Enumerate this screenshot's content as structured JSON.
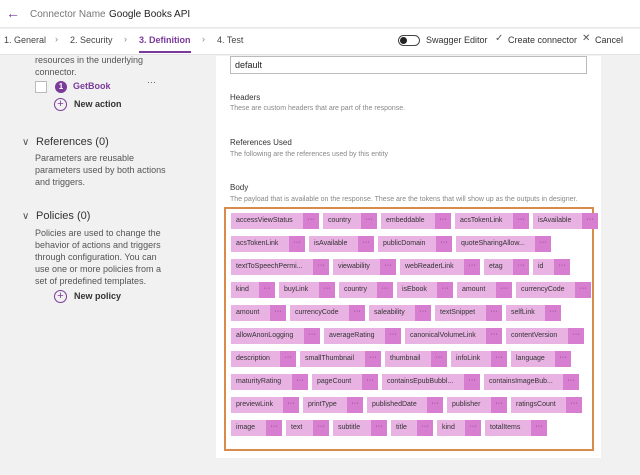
{
  "header": {
    "back_icon": "back-arrow-icon",
    "connector_label": "Connector Name",
    "connector_value": "Google Books API"
  },
  "steps": [
    "1. General",
    "2. Security",
    "3. Definition",
    "4. Test"
  ],
  "active_step": 2,
  "toolbar": {
    "swagger_label": "Swagger Editor",
    "swagger_on": false,
    "create_label": "Create connector",
    "cancel_label": "Cancel"
  },
  "sidebar": {
    "actions_text": [
      "resources in the underlying",
      "connector."
    ],
    "action": {
      "number": "1",
      "name": "GetBook",
      "more": "···"
    },
    "new_action": "New action",
    "references": {
      "title": "References (0)",
      "text": [
        "Parameters are reusable",
        "parameters used by both actions",
        "and triggers."
      ]
    },
    "policies": {
      "title": "Policies (0)",
      "text": [
        "Policies are used to change the",
        "behavior of actions and triggers",
        "through configuration. You can",
        "use one or more policies from a",
        "set of predefined templates."
      ]
    },
    "new_policy": "New policy"
  },
  "main": {
    "default_value": "default",
    "headers_title": "Headers",
    "headers_desc": "These are custom headers that are part of the response.",
    "refs_title": "References Used",
    "refs_desc": "The following are the references used by this entity",
    "body_title": "Body",
    "body_desc": "The payload that is available on the response. These are the tokens that will show up as the outputs in designer.",
    "token_more": "···",
    "token_rows": [
      [
        "accessViewStatus",
        "country",
        "embeddable",
        "acsTokenLink",
        "isAvailable"
      ],
      [
        "acsTokenLink",
        "isAvailable",
        "publicDomain",
        "quoteSharingAllow..."
      ],
      [
        "textToSpeechPermi...",
        "viewability",
        "webReaderLink",
        "etag",
        "id"
      ],
      [
        "kind",
        "buyLink",
        "country",
        "isEbook",
        "amount",
        "currencyCode"
      ],
      [
        "amount",
        "currencyCode",
        "saleability",
        "textSnippet",
        "selfLink"
      ],
      [
        "allowAnonLogging",
        "averageRating",
        "canonicalVolumeLink",
        "contentVersion"
      ],
      [
        "description",
        "smallThumbnail",
        "thumbnail",
        "infoLink",
        "language"
      ],
      [
        "maturityRating",
        "pageCount",
        "containsEpubBubbl...",
        "containsImageBub..."
      ],
      [
        "previewLink",
        "printType",
        "publishedDate",
        "publisher",
        "ratingsCount"
      ],
      [
        "image",
        "text",
        "subtitle",
        "title",
        "kind",
        "totalItems"
      ]
    ]
  }
}
